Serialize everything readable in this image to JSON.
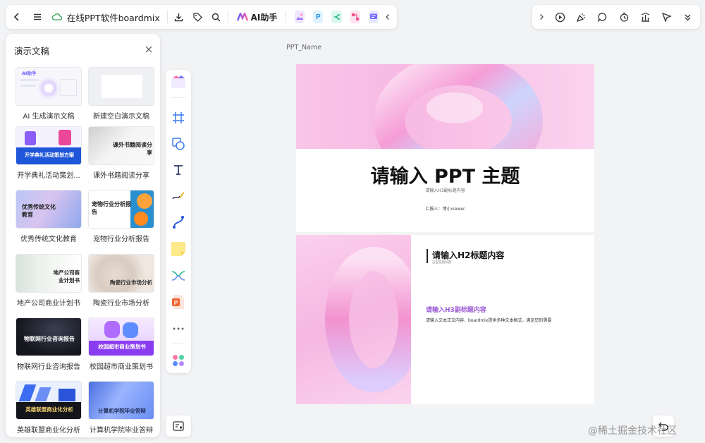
{
  "topbar": {
    "doc_title": "在线PPT软件boardmix",
    "ai_label": "AI助手"
  },
  "panel": {
    "title": "演示文稿",
    "templates": [
      {
        "label": "AI 生成演示文稿",
        "thumb_text": "AI助手"
      },
      {
        "label": "新建空白演示文稿",
        "thumb_text": ""
      },
      {
        "label": "开学典礼活动策划...",
        "thumb_text": "开学典礼活动策划方案"
      },
      {
        "label": "课外书籍阅读分享",
        "thumb_text": "课外书籍阅读分享"
      },
      {
        "label": "优秀传统文化教育",
        "thumb_text": "优秀传统文化教育"
      },
      {
        "label": "宠物行业分析报告",
        "thumb_text": "宠物行业分析报告"
      },
      {
        "label": "地产公司商业计划书",
        "thumb_text": "地产公司商业计划书"
      },
      {
        "label": "陶瓷行业市场分析",
        "thumb_text": "陶瓷行业市场分析"
      },
      {
        "label": "物联网行业咨询报告",
        "thumb_text": "物联网行业咨询报告"
      },
      {
        "label": "校园超市商业策划书",
        "thumb_text": "校园超市商业策划书"
      },
      {
        "label": "英雄联盟商业化分析",
        "thumb_text": "英雄联盟商业化分析"
      },
      {
        "label": "计算机学院毕业答辩",
        "thumb_text": "计算机学院毕业答辩"
      }
    ]
  },
  "canvas": {
    "ppt_name": "PPT_Name",
    "slide1": {
      "title": "请输入 PPT 主题",
      "subtitle": "请输入H3副标题内容",
      "reporter": "汇报人：博小viewer"
    },
    "slide2": {
      "h2": "请输入H2标题内容",
      "h2_sub": "这里是副标题",
      "h3": "请输入H3副标题内容",
      "body": "请输入文本正文内容，boardmix提供多种文本格式，满足您的需要"
    }
  },
  "watermark": "@稀土掘金技术社区",
  "colors": {
    "accent_purple": "#9b59d6",
    "slide_pink": "#f7b9e3",
    "toolbar_bg": "#ffffff",
    "canvas_bg": "#f2f3f5"
  }
}
